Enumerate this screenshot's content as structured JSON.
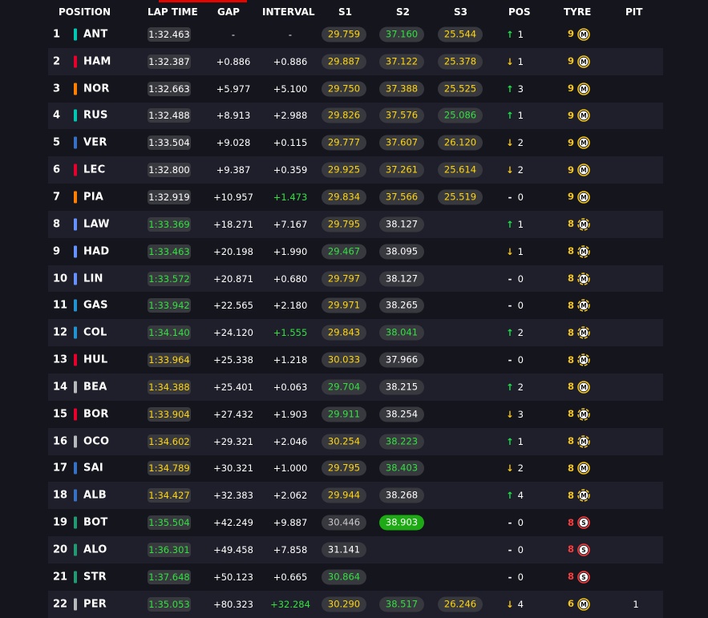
{
  "columns": {
    "position": "POSITION",
    "lap_time": "LAP TIME",
    "gap": "GAP",
    "interval": "INTERVAL",
    "s1": "S1",
    "s2": "S2",
    "s3": "S3",
    "pos": "POS",
    "tyre": "TYRE",
    "pit": "PIT"
  },
  "colors": {
    "yellow": "#ffd60a",
    "green": "#32e040",
    "purple_green_bg": "#1eaa14",
    "pill": "#38383f",
    "row_alt": "#1f1f2b",
    "background": "#15151e"
  },
  "rows": [
    {
      "pos": "1",
      "team": "#00c7b1",
      "code": "ANT",
      "lap": "1:32.463",
      "lap_c": "white",
      "gap": "-",
      "int": "-",
      "int_c": "white",
      "s1": "29.759",
      "s1_c": "yellow",
      "s2": "37.160",
      "s2_c": "green",
      "s3": "25.544",
      "s3_c": "yellow",
      "arrow": "up",
      "delta": "1",
      "tyre_life": "9",
      "tyre_c": "y",
      "compound": "M",
      "new": false,
      "pit": ""
    },
    {
      "pos": "2",
      "team": "#e8002d",
      "code": "HAM",
      "lap": "1:32.387",
      "lap_c": "white",
      "gap": "+0.886",
      "int": "+0.886",
      "int_c": "white",
      "s1": "29.887",
      "s1_c": "yellow",
      "s2": "37.122",
      "s2_c": "yellow",
      "s3": "25.378",
      "s3_c": "yellow",
      "arrow": "down",
      "delta": "1",
      "tyre_life": "9",
      "tyre_c": "y",
      "compound": "M",
      "new": false,
      "pit": ""
    },
    {
      "pos": "3",
      "team": "#ff8000",
      "code": "NOR",
      "lap": "1:32.663",
      "lap_c": "white",
      "gap": "+5.977",
      "int": "+5.100",
      "int_c": "white",
      "s1": "29.750",
      "s1_c": "yellow",
      "s2": "37.388",
      "s2_c": "yellow",
      "s3": "25.525",
      "s3_c": "yellow",
      "arrow": "up",
      "delta": "3",
      "tyre_life": "9",
      "tyre_c": "y",
      "compound": "M",
      "new": false,
      "pit": ""
    },
    {
      "pos": "4",
      "team": "#00c7b1",
      "code": "RUS",
      "lap": "1:32.488",
      "lap_c": "white",
      "gap": "+8.913",
      "int": "+2.988",
      "int_c": "white",
      "s1": "29.826",
      "s1_c": "yellow",
      "s2": "37.576",
      "s2_c": "yellow",
      "s3": "25.086",
      "s3_c": "green",
      "arrow": "up",
      "delta": "1",
      "tyre_life": "9",
      "tyre_c": "y",
      "compound": "M",
      "new": false,
      "pit": ""
    },
    {
      "pos": "5",
      "team": "#3671c6",
      "code": "VER",
      "lap": "1:33.504",
      "lap_c": "white",
      "gap": "+9.028",
      "int": "+0.115",
      "int_c": "white",
      "s1": "29.777",
      "s1_c": "yellow",
      "s2": "37.607",
      "s2_c": "yellow",
      "s3": "26.120",
      "s3_c": "yellow",
      "arrow": "down",
      "delta": "2",
      "tyre_life": "9",
      "tyre_c": "y",
      "compound": "M",
      "new": false,
      "pit": ""
    },
    {
      "pos": "6",
      "team": "#e8002d",
      "code": "LEC",
      "lap": "1:32.800",
      "lap_c": "white",
      "gap": "+9.387",
      "int": "+0.359",
      "int_c": "white",
      "s1": "29.925",
      "s1_c": "yellow",
      "s2": "37.261",
      "s2_c": "yellow",
      "s3": "25.614",
      "s3_c": "yellow",
      "arrow": "down",
      "delta": "2",
      "tyre_life": "9",
      "tyre_c": "y",
      "compound": "M",
      "new": false,
      "pit": ""
    },
    {
      "pos": "7",
      "team": "#ff8000",
      "code": "PIA",
      "lap": "1:32.919",
      "lap_c": "white",
      "gap": "+10.957",
      "int": "+1.473",
      "int_c": "green",
      "s1": "29.834",
      "s1_c": "yellow",
      "s2": "37.566",
      "s2_c": "yellow",
      "s3": "25.519",
      "s3_c": "yellow",
      "arrow": "none",
      "delta": "0",
      "tyre_life": "9",
      "tyre_c": "y",
      "compound": "M",
      "new": false,
      "pit": ""
    },
    {
      "pos": "8",
      "team": "#6692ff",
      "code": "LAW",
      "lap": "1:33.369",
      "lap_c": "green",
      "gap": "+18.271",
      "int": "+7.167",
      "int_c": "white",
      "s1": "29.795",
      "s1_c": "yellow",
      "s2": "38.127",
      "s2_c": "white",
      "s3": "",
      "s3_c": "white",
      "arrow": "up",
      "delta": "1",
      "tyre_life": "8",
      "tyre_c": "y",
      "compound": "M",
      "new": true,
      "pit": ""
    },
    {
      "pos": "9",
      "team": "#6692ff",
      "code": "HAD",
      "lap": "1:33.463",
      "lap_c": "green",
      "gap": "+20.198",
      "int": "+1.990",
      "int_c": "white",
      "s1": "29.467",
      "s1_c": "green",
      "s2": "38.095",
      "s2_c": "white",
      "s3": "",
      "s3_c": "white",
      "arrow": "down",
      "delta": "1",
      "tyre_life": "8",
      "tyre_c": "y",
      "compound": "M",
      "new": true,
      "pit": ""
    },
    {
      "pos": "10",
      "team": "#6692ff",
      "code": "LIN",
      "lap": "1:33.572",
      "lap_c": "green",
      "gap": "+20.871",
      "int": "+0.680",
      "int_c": "white",
      "s1": "29.797",
      "s1_c": "yellow",
      "s2": "38.127",
      "s2_c": "white",
      "s3": "",
      "s3_c": "white",
      "arrow": "none",
      "delta": "0",
      "tyre_life": "8",
      "tyre_c": "y",
      "compound": "M",
      "new": true,
      "pit": ""
    },
    {
      "pos": "11",
      "team": "#2293d1",
      "code": "GAS",
      "lap": "1:33.942",
      "lap_c": "green",
      "gap": "+22.565",
      "int": "+2.180",
      "int_c": "white",
      "s1": "29.971",
      "s1_c": "yellow",
      "s2": "38.265",
      "s2_c": "white",
      "s3": "",
      "s3_c": "white",
      "arrow": "none",
      "delta": "0",
      "tyre_life": "8",
      "tyre_c": "y",
      "compound": "M",
      "new": true,
      "pit": ""
    },
    {
      "pos": "12",
      "team": "#2293d1",
      "code": "COL",
      "lap": "1:34.140",
      "lap_c": "green",
      "gap": "+24.120",
      "int": "+1.555",
      "int_c": "green",
      "s1": "29.843",
      "s1_c": "yellow",
      "s2": "38.041",
      "s2_c": "green",
      "s3": "",
      "s3_c": "white",
      "arrow": "up",
      "delta": "2",
      "tyre_life": "8",
      "tyre_c": "y",
      "compound": "M",
      "new": true,
      "pit": ""
    },
    {
      "pos": "13",
      "team": "#e8002d",
      "code": "HUL",
      "lap": "1:33.964",
      "lap_c": "yellow",
      "gap": "+25.338",
      "int": "+1.218",
      "int_c": "white",
      "s1": "30.033",
      "s1_c": "yellow",
      "s2": "37.966",
      "s2_c": "white",
      "s3": "",
      "s3_c": "white",
      "arrow": "none",
      "delta": "0",
      "tyre_life": "8",
      "tyre_c": "y",
      "compound": "M",
      "new": true,
      "pit": ""
    },
    {
      "pos": "14",
      "team": "#b6babd",
      "code": "BEA",
      "lap": "1:34.388",
      "lap_c": "yellow",
      "gap": "+25.401",
      "int": "+0.063",
      "int_c": "white",
      "s1": "29.704",
      "s1_c": "green",
      "s2": "38.215",
      "s2_c": "white",
      "s3": "",
      "s3_c": "white",
      "arrow": "up",
      "delta": "2",
      "tyre_life": "8",
      "tyre_c": "y",
      "compound": "M",
      "new": false,
      "pit": ""
    },
    {
      "pos": "15",
      "team": "#e8002d",
      "code": "BOR",
      "lap": "1:33.904",
      "lap_c": "yellow",
      "gap": "+27.432",
      "int": "+1.903",
      "int_c": "white",
      "s1": "29.911",
      "s1_c": "green",
      "s2": "38.254",
      "s2_c": "white",
      "s3": "",
      "s3_c": "white",
      "arrow": "down",
      "delta": "3",
      "tyre_life": "8",
      "tyre_c": "y",
      "compound": "M",
      "new": true,
      "pit": ""
    },
    {
      "pos": "16",
      "team": "#b6babd",
      "code": "OCO",
      "lap": "1:34.602",
      "lap_c": "yellow",
      "gap": "+29.321",
      "int": "+2.046",
      "int_c": "white",
      "s1": "30.254",
      "s1_c": "yellow",
      "s2": "38.223",
      "s2_c": "green",
      "s3": "",
      "s3_c": "white",
      "arrow": "up",
      "delta": "1",
      "tyre_life": "8",
      "tyre_c": "y",
      "compound": "M",
      "new": true,
      "pit": ""
    },
    {
      "pos": "17",
      "team": "#3671c6",
      "code": "SAI",
      "lap": "1:34.789",
      "lap_c": "yellow",
      "gap": "+30.321",
      "int": "+1.000",
      "int_c": "white",
      "s1": "29.795",
      "s1_c": "yellow",
      "s2": "38.403",
      "s2_c": "green",
      "s3": "",
      "s3_c": "white",
      "arrow": "down",
      "delta": "2",
      "tyre_life": "8",
      "tyre_c": "y",
      "compound": "M",
      "new": false,
      "pit": ""
    },
    {
      "pos": "18",
      "team": "#3671c6",
      "code": "ALB",
      "lap": "1:34.427",
      "lap_c": "yellow",
      "gap": "+32.383",
      "int": "+2.062",
      "int_c": "white",
      "s1": "29.944",
      "s1_c": "yellow",
      "s2": "38.268",
      "s2_c": "white",
      "s3": "",
      "s3_c": "white",
      "arrow": "up",
      "delta": "4",
      "tyre_life": "8",
      "tyre_c": "y",
      "compound": "M",
      "new": true,
      "pit": ""
    },
    {
      "pos": "19",
      "team": "#229971",
      "code": "BOT",
      "lap": "1:35.504",
      "lap_c": "green",
      "gap": "+42.249",
      "int": "+9.887",
      "int_c": "white",
      "s1": "30.446",
      "s1_c": "gray",
      "s2": "38.903",
      "s2_c": "bggreen",
      "s3": "",
      "s3_c": "white",
      "arrow": "none",
      "delta": "0",
      "tyre_life": "8",
      "tyre_c": "r",
      "compound": "S",
      "new": false,
      "pit": ""
    },
    {
      "pos": "20",
      "team": "#229971",
      "code": "ALO",
      "lap": "1:36.301",
      "lap_c": "green",
      "gap": "+49.458",
      "int": "+7.858",
      "int_c": "white",
      "s1": "31.141",
      "s1_c": "white",
      "s2": "",
      "s2_c": "white",
      "s3": "",
      "s3_c": "white",
      "arrow": "none",
      "delta": "0",
      "tyre_life": "8",
      "tyre_c": "r",
      "compound": "S",
      "new": false,
      "pit": ""
    },
    {
      "pos": "21",
      "team": "#229971",
      "code": "STR",
      "lap": "1:37.648",
      "lap_c": "green",
      "gap": "+50.123",
      "int": "+0.665",
      "int_c": "white",
      "s1": "30.864",
      "s1_c": "green",
      "s2": "",
      "s2_c": "white",
      "s3": "",
      "s3_c": "white",
      "arrow": "none",
      "delta": "0",
      "tyre_life": "8",
      "tyre_c": "r",
      "compound": "S",
      "new": false,
      "pit": ""
    },
    {
      "pos": "22",
      "team": "#b6babd",
      "code": "PER",
      "lap": "1:35.053",
      "lap_c": "green",
      "gap": "+80.323",
      "int": "+32.284",
      "int_c": "green",
      "s1": "30.290",
      "s1_c": "yellow",
      "s2": "38.517",
      "s2_c": "green",
      "s3": "26.246",
      "s3_c": "yellow",
      "arrow": "down",
      "delta": "4",
      "tyre_life": "6",
      "tyre_c": "y",
      "compound": "M",
      "new": false,
      "pit": "1"
    }
  ]
}
